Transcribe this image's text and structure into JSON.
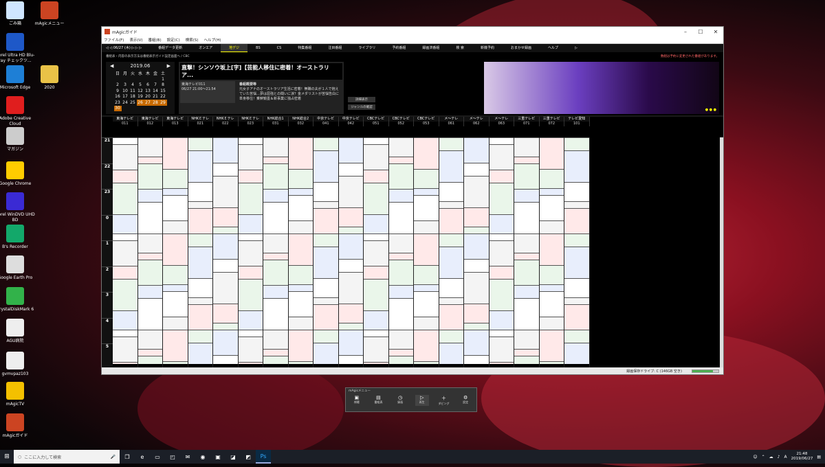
{
  "desktop": {
    "icons_left": [
      {
        "label": "ごみ箱",
        "icon": "recycle-bin-icon",
        "color": "#cfe6ff"
      },
      {
        "label": "Corel Ultra HD Blu-ray チェックツ...",
        "icon": "corel-icon",
        "color": "#1e58c8"
      },
      {
        "label": "Microsoft Edge",
        "icon": "edge-icon",
        "color": "#1e7fd6"
      },
      {
        "label": "Adobe Creative Cloud",
        "icon": "adobe-icon",
        "color": "#e01e1e"
      },
      {
        "label": "マガジン",
        "icon": "magazine-icon",
        "color": "#cccccc"
      },
      {
        "label": "Google Chrome",
        "icon": "chrome-icon",
        "color": "#ffcc00"
      },
      {
        "label": "Corel WinDVD UHD BD",
        "icon": "windvd-icon",
        "color": "#3a2ad4"
      },
      {
        "label": "B's Recorder",
        "icon": "bs-recorder-icon",
        "color": "#13a86a"
      },
      {
        "label": "Google Earth Pro",
        "icon": "earth-icon",
        "color": "#dddddd"
      },
      {
        "label": "CrystalDiskMark 6",
        "icon": "crystaldisk-icon",
        "color": "#32b24a"
      },
      {
        "label": "AGU病院",
        "icon": "doc-icon",
        "color": "#eeeeee"
      },
      {
        "label": "gvmvpaz103",
        "icon": "doc-icon",
        "color": "#eeeeee"
      },
      {
        "label": "mAgicTV",
        "icon": "magictv-icon",
        "color": "#f4c000"
      },
      {
        "label": "mAgicガイド",
        "icon": "magicguide-icon",
        "color": "#c42"
      }
    ],
    "icons_col2": [
      {
        "label": "mAgicメニュー",
        "icon": "magic-menu-icon",
        "color": "#c42"
      },
      {
        "label": "2020",
        "icon": "folder-icon",
        "color": "#e9c247"
      }
    ]
  },
  "window": {
    "title": "mAgicガイド",
    "menu": [
      "ファイル(F)",
      "表示(V)",
      "番組(B)",
      "設定(C)",
      "検索(S)",
      "ヘルプ(H)"
    ],
    "toolbar": {
      "nav": "◁ ◁ 06/27 (木) ▷ ▷ ▷",
      "tabs": [
        "番組データ更新",
        "オンエア",
        "地デジ",
        "BS",
        "CS",
        "特集番組",
        "注目番組",
        "ライブラリ",
        "予約番組",
        "録画済番組",
        "検 索",
        "新機予約",
        "おまかせ録画",
        "ヘルプ",
        "▷"
      ],
      "active_tab": "地デジ"
    },
    "info": {
      "left": "番組表・内容の表示方法は番組表示ガイド設定画面へ / CBC",
      "right": "数組は予約に変更された番組があります。"
    },
    "calendar": {
      "month": "2019.06",
      "weekdays": [
        "日",
        "月",
        "火",
        "水",
        "木",
        "金",
        "土"
      ],
      "rows": [
        [
          "",
          "",
          "",
          "",
          "",
          "",
          "1"
        ],
        [
          "2",
          "3",
          "4",
          "5",
          "6",
          "7",
          "8"
        ],
        [
          "9",
          "10",
          "11",
          "12",
          "13",
          "14",
          "15"
        ],
        [
          "16",
          "17",
          "18",
          "19",
          "20",
          "21",
          "22"
        ],
        [
          "23",
          "24",
          "25",
          "26",
          "27",
          "28",
          "29"
        ],
        [
          "30",
          "",
          "",
          "",
          "",
          "",
          ""
        ]
      ]
    },
    "program": {
      "title": "直撃！シンソウ坂上[字]【芸能人移住に密着！オーストラリア...",
      "channel": "東海テレビ011",
      "time": "06/27 21:00〜21:54",
      "genre": "番組概要等",
      "body": "元女子アナのオーストラリア生活に密着！無職の夫が１人で抱えていた苦悩…夢は屈強との聞いに涙？金メダリストが苦悩告白に単身移住！乗鮮鏡墨＆新事業に独占密着"
    },
    "buttons": [
      "詳細表示",
      "ジャンルの確認"
    ],
    "channels": [
      {
        "name": "東海テレビ",
        "num": "011"
      },
      {
        "name": "東海テレビ",
        "num": "012"
      },
      {
        "name": "東海テレビ",
        "num": "013"
      },
      {
        "name": "NHKＥテレ",
        "num": "021"
      },
      {
        "name": "NHKＥテレ",
        "num": "022"
      },
      {
        "name": "NHKＥテレ",
        "num": "023"
      },
      {
        "name": "NHK総合1",
        "num": "031"
      },
      {
        "name": "NHK総合2",
        "num": "032"
      },
      {
        "name": "中京テレビ",
        "num": "041"
      },
      {
        "name": "中京テレビ",
        "num": "042"
      },
      {
        "name": "CBCテレビ",
        "num": "051"
      },
      {
        "name": "CBCテレビ",
        "num": "052"
      },
      {
        "name": "CBCテレビ",
        "num": "053"
      },
      {
        "name": "メ〜テレ",
        "num": "061"
      },
      {
        "name": "メ〜テレ",
        "num": "062"
      },
      {
        "name": "メ〜テレ",
        "num": "063"
      },
      {
        "name": "三重テレビ",
        "num": "071"
      },
      {
        "name": "三重テレビ",
        "num": "072"
      },
      {
        "name": "テレビ愛知",
        "num": "101"
      }
    ],
    "hours": [
      "21",
      "22",
      "23",
      "0",
      "1",
      "2",
      "3",
      "4",
      "5"
    ],
    "status": "録画保存ドライブ: C (146GB 空き)"
  },
  "remote": {
    "title": "mAgicメニュー",
    "items": [
      "視聴",
      "番組表",
      "録画",
      "再生",
      "ダビング",
      "設定"
    ],
    "active": "再生"
  },
  "taskbar": {
    "search_placeholder": "ここに入力して検索",
    "time": "21:48",
    "date": "2019/06/27"
  }
}
